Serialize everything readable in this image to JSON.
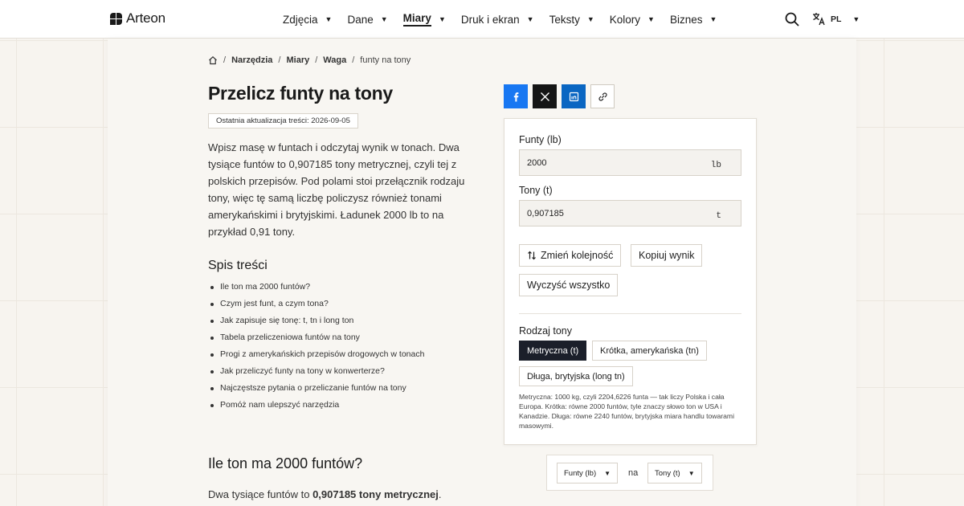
{
  "header": {
    "logo_text": "Arteon",
    "nav": [
      {
        "label": "Zdjęcia"
      },
      {
        "label": "Dane"
      },
      {
        "label": "Miary"
      },
      {
        "label": "Druk i ekran"
      },
      {
        "label": "Teksty"
      },
      {
        "label": "Kolory"
      },
      {
        "label": "Biznes"
      }
    ],
    "active_nav": "Miary",
    "lang": "PL"
  },
  "breadcrumb": {
    "items": [
      "Narzędzia",
      "Miary",
      "Waga"
    ],
    "current": "funty na tony"
  },
  "page": {
    "title": "Przelicz funty na tony",
    "updated": "Ostatnia aktualizacja treści: 2026-09-05",
    "intro": "Wpisz masę w funtach i odczytaj wynik w tonach. Dwa tysiące funtów to 0,907185 tony metrycznej, czyli tej z polskich przepisów. Pod polami stoi przełącznik rodzaju tony, więc tę samą liczbę policzysz również tonami amerykańskimi i brytyjskimi. Ładunek 2000 lb to na przykład 0,91 tony.",
    "toc_title": "Spis treści",
    "toc": [
      "Ile ton ma 2000 funtów?",
      "Czym jest funt, a czym tona?",
      "Jak zapisuje się tonę: t, tn i long ton",
      "Tabela przeliczeniowa funtów na tony",
      "Progi z amerykańskich przepisów drogowych w tonach",
      "Jak przeliczyć funty na tony w konwerterze?",
      "Najczęstsze pytania o przeliczanie funtów na tony",
      "Pomóż nam ulepszyć narzędzia"
    ],
    "section_title": "Ile ton ma 2000 funtów?",
    "answer_prefix": "Dwa tysiące funtów to ",
    "answer_bold": "0,907185 tony metrycznej",
    "answer_suffix": "."
  },
  "converter": {
    "from_label": "Funty (lb)",
    "from_value": "2000",
    "from_unit": "lb",
    "to_label": "Tony (t)",
    "to_value": "0,907185",
    "to_unit": "t",
    "swap_label": "Zmień kolejność",
    "copy_label": "Kopiuj wynik",
    "clear_label": "Wyczyść wszystko",
    "type_label": "Rodzaj tony",
    "types": [
      "Metryczna (t)",
      "Krótka, amerykańska (tn)",
      "Długa, brytyjska (long tn)"
    ],
    "active_type": "Metryczna (t)",
    "note": "Metryczna: 1000 kg, czyli 2204,6226 funta — tak liczy Polska i cała Europa. Krótka: równe 2000 funtów, tyle znaczy słowo ton w USA i Kanadzie. Długa: równe 2240 funtów, brytyjska miara handlu towarami masowymi."
  },
  "unit_pair": {
    "from": "Funty (lb)",
    "connector": "na",
    "to": "Tony (t)"
  },
  "colors": {
    "facebook": "#1877f2",
    "x": "#151515",
    "linkedin": "#0a66c2",
    "active_chip": "#1b1f2a"
  }
}
